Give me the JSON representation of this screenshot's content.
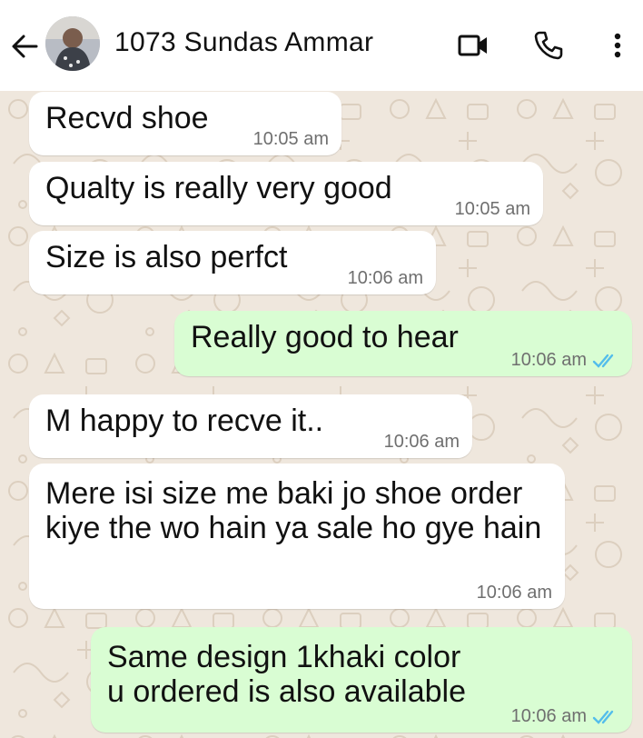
{
  "header": {
    "contact_name": "1073 Sundas Ammar",
    "icons": [
      "back-arrow-icon",
      "video-call-icon",
      "phone-icon",
      "more-options-icon"
    ]
  },
  "colors": {
    "incoming_bubble": "#ffffff",
    "outgoing_bubble": "#d9fdd3",
    "read_ticks": "#53bdeb",
    "chat_background": "#efe7dd"
  },
  "messages": [
    {
      "direction": "incoming",
      "text": "Recvd shoe",
      "time": "10:05 am"
    },
    {
      "direction": "incoming",
      "text": "Qualty is really very good",
      "time": "10:05 am"
    },
    {
      "direction": "incoming",
      "text": "Size is also perfct",
      "time": "10:06 am"
    },
    {
      "direction": "outgoing",
      "text": "Really good to hear",
      "time": "10:06 am",
      "status": "read"
    },
    {
      "direction": "incoming",
      "text": "M happy to recve it..",
      "time": "10:06 am"
    },
    {
      "direction": "incoming",
      "text": "Mere isi size me baki jo shoe order kiye the wo hain ya sale ho gye hain",
      "time": "10:06 am"
    },
    {
      "direction": "outgoing",
      "text": "Same design 1khaki color u ordered is also available",
      "time": "10:06 am",
      "status": "read"
    }
  ]
}
